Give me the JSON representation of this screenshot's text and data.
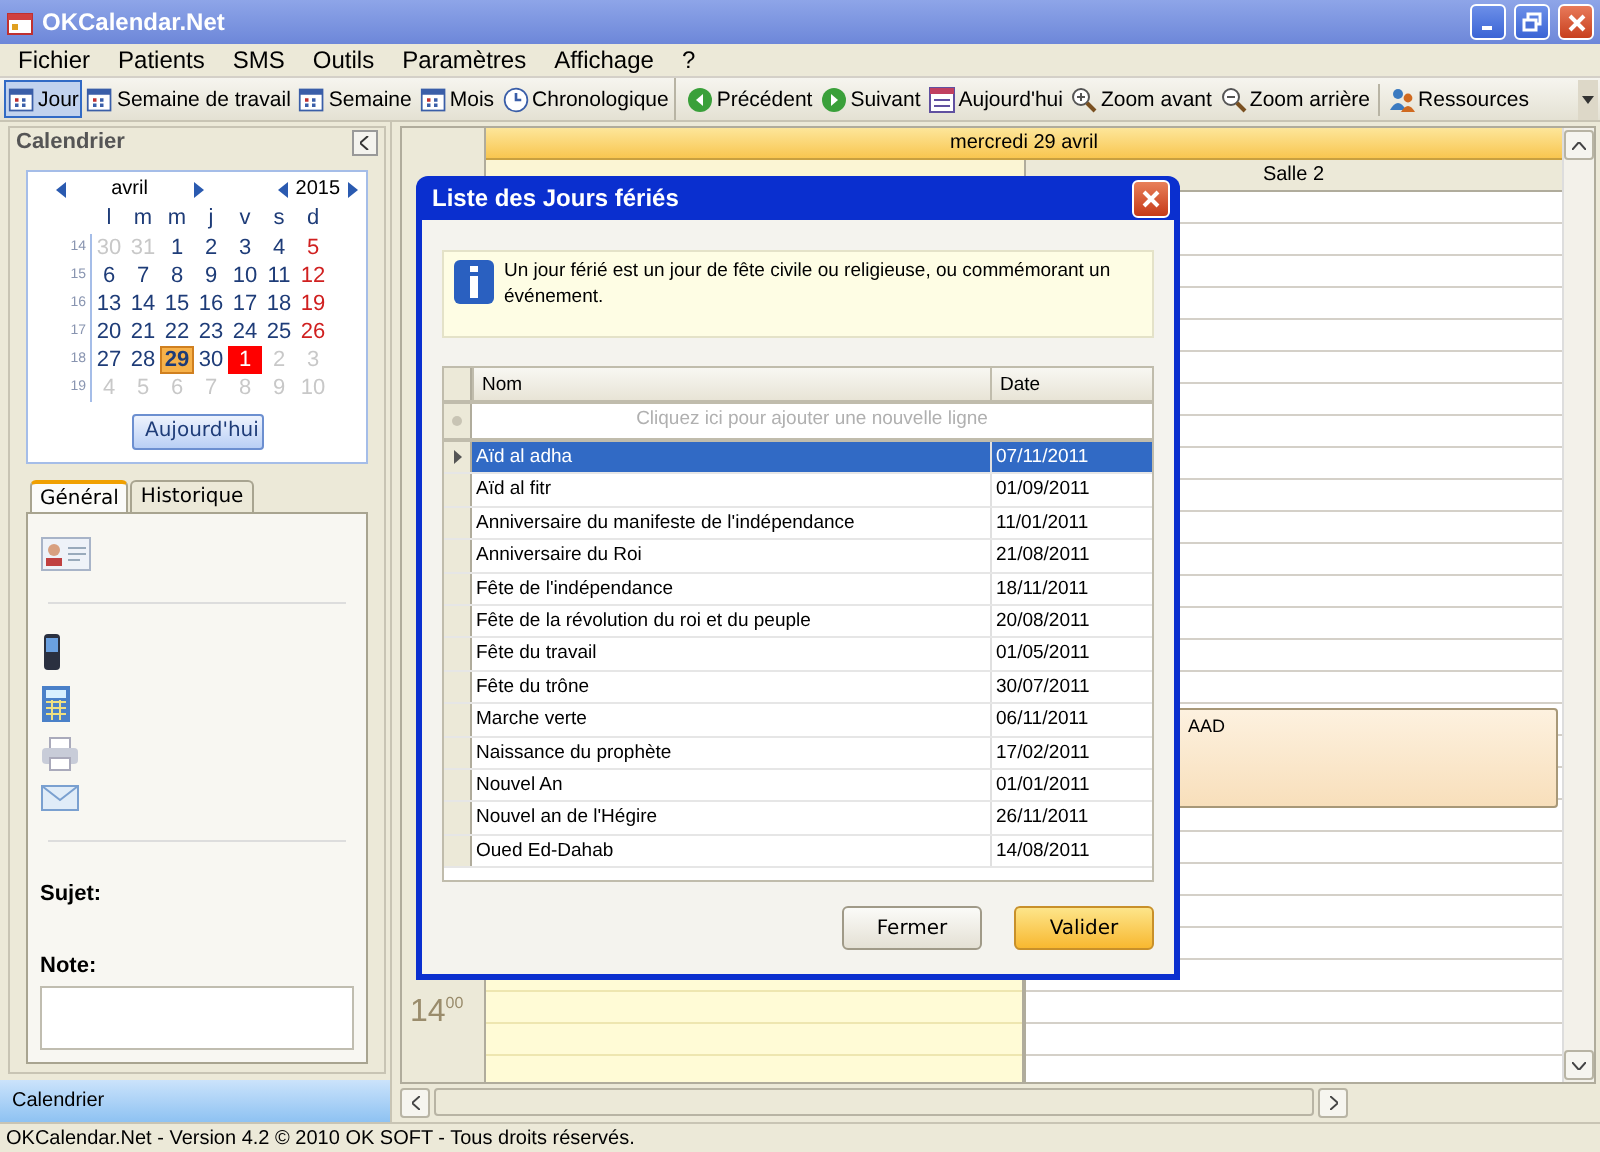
{
  "window": {
    "title": "OKCalendar.Net"
  },
  "menu": [
    "Fichier",
    "Patients",
    "SMS",
    "Outils",
    "Paramètres",
    "Affichage",
    "?"
  ],
  "toolbar_views": [
    {
      "label": "Jour",
      "selected": true
    },
    {
      "label": "Semaine de travail",
      "selected": false
    },
    {
      "label": "Semaine",
      "selected": false
    },
    {
      "label": "Mois",
      "selected": false
    },
    {
      "label": "Chronologique",
      "selected": false,
      "kind": "clock"
    }
  ],
  "toolbar_nav": [
    {
      "label": "Précédent",
      "kind": "prev"
    },
    {
      "label": "Suivant",
      "kind": "next"
    },
    {
      "label": "Aujourd'hui",
      "kind": "today"
    },
    {
      "label": "Zoom avant",
      "kind": "zoomin"
    },
    {
      "label": "Zoom arrière",
      "kind": "zoomout"
    },
    {
      "label": "Ressources",
      "kind": "resources"
    }
  ],
  "sidebar": {
    "title": "Calendrier",
    "mini_calendar": {
      "month": "avril",
      "year": "2015",
      "weekdays": [
        "l",
        "m",
        "m",
        "j",
        "v",
        "s",
        "d"
      ],
      "weeks": [
        {
          "number": "14",
          "days": [
            {
              "day": "30",
              "kind": "other"
            },
            {
              "day": "31",
              "kind": "other"
            },
            {
              "day": "1",
              "kind": "normal"
            },
            {
              "day": "2",
              "kind": "normal"
            },
            {
              "day": "3",
              "kind": "normal"
            },
            {
              "day": "4",
              "kind": "normal"
            },
            {
              "day": "5",
              "kind": "weekend"
            }
          ]
        },
        {
          "number": "15",
          "days": [
            {
              "day": "6",
              "kind": "normal"
            },
            {
              "day": "7",
              "kind": "normal"
            },
            {
              "day": "8",
              "kind": "normal"
            },
            {
              "day": "9",
              "kind": "normal"
            },
            {
              "day": "10",
              "kind": "normal"
            },
            {
              "day": "11",
              "kind": "normal"
            },
            {
              "day": "12",
              "kind": "weekend"
            }
          ]
        },
        {
          "number": "16",
          "days": [
            {
              "day": "13",
              "kind": "normal"
            },
            {
              "day": "14",
              "kind": "normal"
            },
            {
              "day": "15",
              "kind": "normal"
            },
            {
              "day": "16",
              "kind": "normal"
            },
            {
              "day": "17",
              "kind": "normal"
            },
            {
              "day": "18",
              "kind": "normal"
            },
            {
              "day": "19",
              "kind": "weekend"
            }
          ]
        },
        {
          "number": "17",
          "days": [
            {
              "day": "20",
              "kind": "normal"
            },
            {
              "day": "21",
              "kind": "normal"
            },
            {
              "day": "22",
              "kind": "normal"
            },
            {
              "day": "23",
              "kind": "normal"
            },
            {
              "day": "24",
              "kind": "normal"
            },
            {
              "day": "25",
              "kind": "normal"
            },
            {
              "day": "26",
              "kind": "weekend"
            }
          ]
        },
        {
          "number": "18",
          "days": [
            {
              "day": "27",
              "kind": "normal"
            },
            {
              "day": "28",
              "kind": "normal"
            },
            {
              "day": "29",
              "kind": "selected"
            },
            {
              "day": "30",
              "kind": "normal"
            },
            {
              "day": "1",
              "kind": "holiday"
            },
            {
              "day": "2",
              "kind": "other"
            },
            {
              "day": "3",
              "kind": "other"
            }
          ]
        },
        {
          "number": "19",
          "days": [
            {
              "day": "4",
              "kind": "other"
            },
            {
              "day": "5",
              "kind": "other"
            },
            {
              "day": "6",
              "kind": "other"
            },
            {
              "day": "7",
              "kind": "other"
            },
            {
              "day": "8",
              "kind": "other"
            },
            {
              "day": "9",
              "kind": "other"
            },
            {
              "day": "10",
              "kind": "other"
            }
          ]
        }
      ]
    },
    "today_button": "Aujourd'hui",
    "tabs": [
      {
        "label": "Général",
        "selected": true
      },
      {
        "label": "Historique",
        "selected": false
      }
    ],
    "subject_label": "Sujet:",
    "note_label": "Note:",
    "nav_button": "Calendrier"
  },
  "scheduler": {
    "day_header": "mercredi 29 avril",
    "resource_header": "Salle 2",
    "time_label": "14$^{00}$",
    "appointment": "AAD"
  },
  "dialog": {
    "title": "Liste des Jours fériés",
    "info": "Un jour férié est un jour de fête civile ou religieuse, ou commémorant un événement.",
    "columns": [
      "Nom",
      "Date"
    ],
    "new_row_placeholder": "Cliquez ici pour ajouter une nouvelle ligne",
    "rows": [
      {
        "name": "Aïd al adha",
        "date": "07/11/2011",
        "selected": true
      },
      {
        "name": "Aïd al fitr",
        "date": "01/09/2011",
        "selected": false
      },
      {
        "name": "Anniversaire du manifeste de l'indépendance",
        "date": "11/01/2011",
        "selected": false
      },
      {
        "name": "Anniversaire du Roi",
        "date": "21/08/2011",
        "selected": false
      },
      {
        "name": "Fête de l'indépendance",
        "date": "18/11/2011",
        "selected": false
      },
      {
        "name": "Fête de la révolution du roi et du peuple",
        "date": "20/08/2011",
        "selected": false
      },
      {
        "name": "Fête du travail",
        "date": "01/05/2011",
        "selected": false
      },
      {
        "name": "Fête du trône",
        "date": "30/07/2011",
        "selected": false
      },
      {
        "name": "Marche verte",
        "date": "06/11/2011",
        "selected": false
      },
      {
        "name": "Naissance du prophète",
        "date": "17/02/2011",
        "selected": false
      },
      {
        "name": "Nouvel An",
        "date": "01/01/2011",
        "selected": false
      },
      {
        "name": "Nouvel an de l'Hégire",
        "date": "26/11/2011",
        "selected": false
      },
      {
        "name": "Oued Ed-Dahab",
        "date": "14/08/2011",
        "selected": false
      }
    ],
    "buttons": [
      {
        "label": "Fermer",
        "kind": "default"
      },
      {
        "label": "Valider",
        "kind": "primary"
      }
    ]
  },
  "status_bar": "OKCalendar.Net - Version 4.2 © 2010 OK SOFT - Tous droits réservés."
}
